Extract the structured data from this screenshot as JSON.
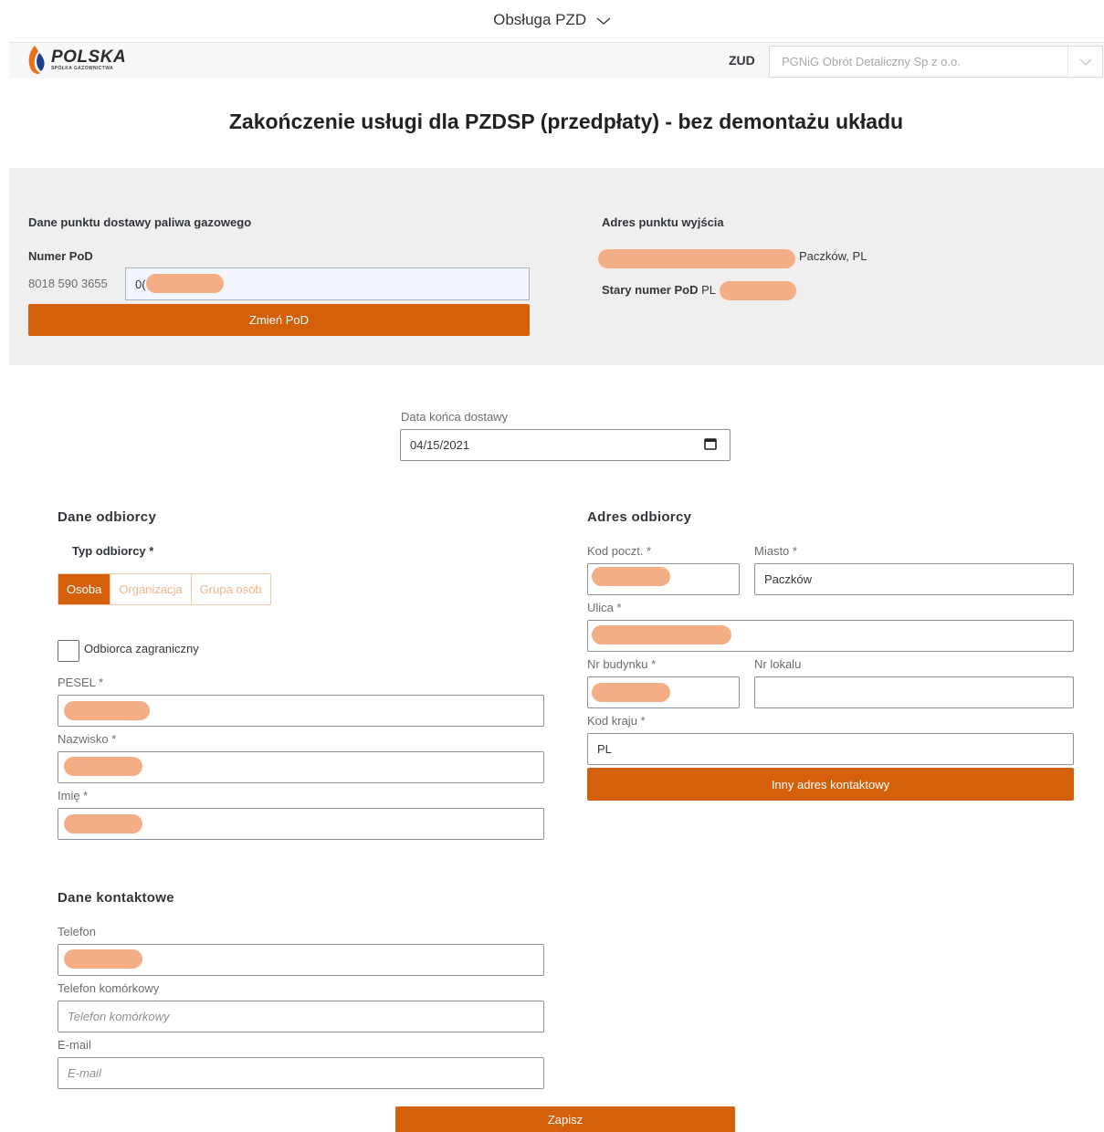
{
  "shell": {
    "title": "Obsługa PZD",
    "logo_main": "POLSKA",
    "logo_sub": "SPÓŁKA GAZOWNICTWA",
    "zud_label": "ZUD",
    "zud_value": "PGNiG Obrót Detaliczny Sp z o.o."
  },
  "page_title": "Zakończenie usługi dla PZDSP (przedpłaty) - bez demontażu układu",
  "pod": {
    "section_title": "Dane punktu dostawy paliwa gazowego",
    "number_label": "Numer PoD",
    "prefix": "8018 590 3655",
    "input_value": "0(",
    "change_button": "Zmień PoD",
    "address_title": "Adres punktu wyjścia",
    "address_value": "Paczków, PL",
    "old_number_label": "Stary numer PoD",
    "old_number_value": "PL"
  },
  "delivery": {
    "end_date_label": "Data końca dostawy",
    "end_date_value": "04/15/2021"
  },
  "recipient": {
    "section_title": "Dane odbiorcy",
    "type_label": "Typ odbiorcy *",
    "types": [
      "Osoba",
      "Organizacja",
      "Grupa osób"
    ],
    "foreign_label": "Odbiorca zagraniczny",
    "pesel_label": "PESEL *",
    "surname_label": "Nazwisko *",
    "name_label": "Imię *"
  },
  "address": {
    "section_title": "Adres odbiorcy",
    "postal_label": "Kod poczt. *",
    "city_label": "Miasto *",
    "city_value": "Paczków",
    "street_label": "Ulica *",
    "building_label": "Nr budynku *",
    "flat_label": "Nr lokalu",
    "country_label": "Kod kraju *",
    "country_value": "PL",
    "other_address_button": "Inny adres kontaktowy"
  },
  "contact": {
    "section_title": "Dane kontaktowe",
    "phone_label": "Telefon",
    "mobile_label": "Telefon komórkowy",
    "mobile_placeholder": "Telefon komórkowy",
    "email_label": "E-mail",
    "email_placeholder": "E-mail"
  },
  "save_button": "Zapisz",
  "colors": {
    "accent": "#d4600c",
    "redaction": "#f4ae85",
    "panel": "#efefef"
  }
}
